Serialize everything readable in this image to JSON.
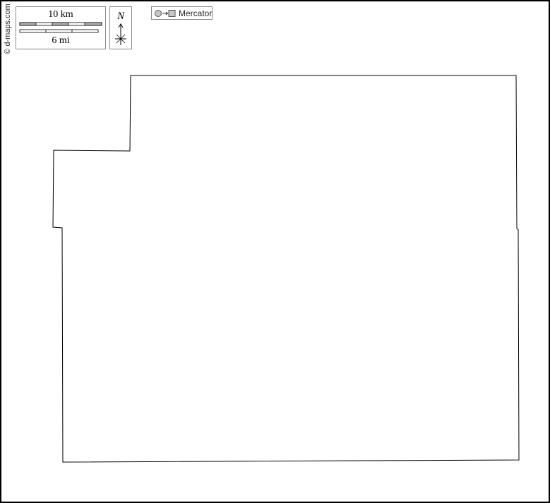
{
  "credit": "© d-maps.com",
  "scale": {
    "km_label": "10 km",
    "mi_label": "6 mi"
  },
  "north": {
    "letter": "N",
    "icon": "compass-rose-icon"
  },
  "projection": {
    "icon": "circle-to-square-icon",
    "label": "Mercator"
  },
  "colors": {
    "border": "#000000",
    "scale_fill": "#b0b0b0",
    "box_border": "#888888"
  }
}
